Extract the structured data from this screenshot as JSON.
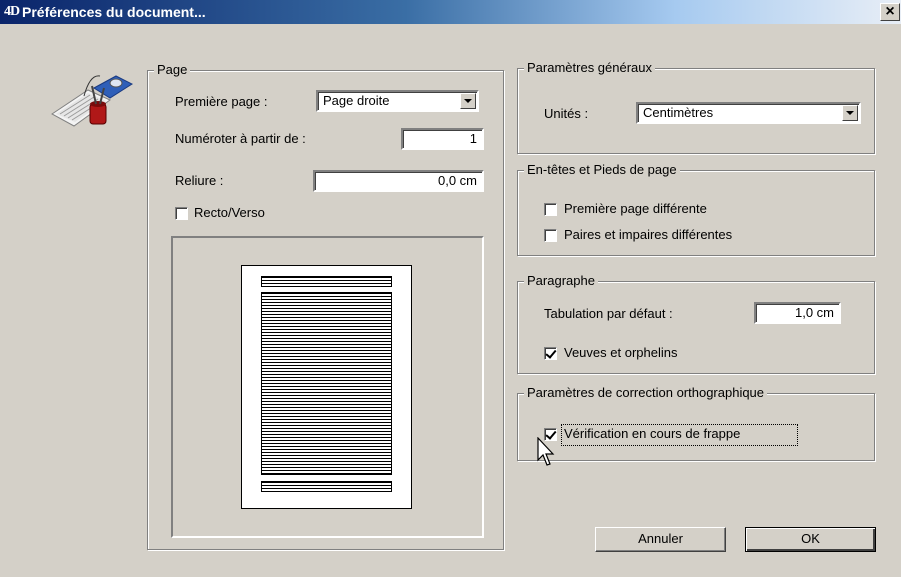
{
  "window": {
    "title": "Préférences du document...",
    "app_logo": "4D",
    "close_symbol": "×"
  },
  "page_group": {
    "legend": "Page",
    "first_page": {
      "label": "Première page :",
      "value": "Page droite"
    },
    "number_from": {
      "label": "Numéroter à partir de :",
      "value": "1"
    },
    "binding": {
      "label": "Reliure :",
      "value": "0,0 cm"
    },
    "duplex": {
      "label": "Recto/Verso",
      "checked": false
    }
  },
  "general_group": {
    "legend": "Paramètres généraux",
    "units": {
      "label": "Unités :",
      "value": "Centimètres"
    }
  },
  "header_footer_group": {
    "legend": "En-têtes et Pieds de page",
    "first_page_different": {
      "label": "Première page différente",
      "checked": false
    },
    "odd_even_different": {
      "label": "Paires et impaires différentes",
      "checked": false
    }
  },
  "paragraph_group": {
    "legend": "Paragraphe",
    "default_tab": {
      "label": "Tabulation par défaut :",
      "value": "1,0 cm"
    },
    "widows_orphans": {
      "label": "Veuves et orphelins",
      "checked": true
    }
  },
  "spelling_group": {
    "legend": "Paramètres de correction orthographique",
    "check_as_you_type": {
      "label": "Vérification en cours de frappe",
      "checked": true
    }
  },
  "buttons": {
    "cancel": "Annuler",
    "ok": "OK"
  },
  "icons": {
    "dialog_icon": "desk-tools-icon",
    "cursor": "mouse-pointer-icon"
  }
}
